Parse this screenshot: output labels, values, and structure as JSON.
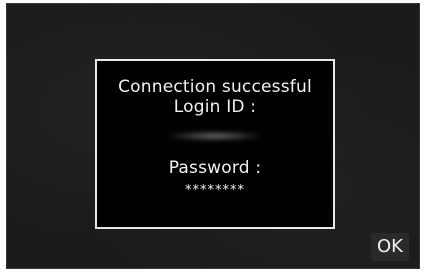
{
  "dialog": {
    "title": "Connection successful",
    "login_label": "Login ID :",
    "login_value": "",
    "password_label": "Password :",
    "password_value": "********"
  },
  "ok_button": {
    "label": "OK"
  }
}
